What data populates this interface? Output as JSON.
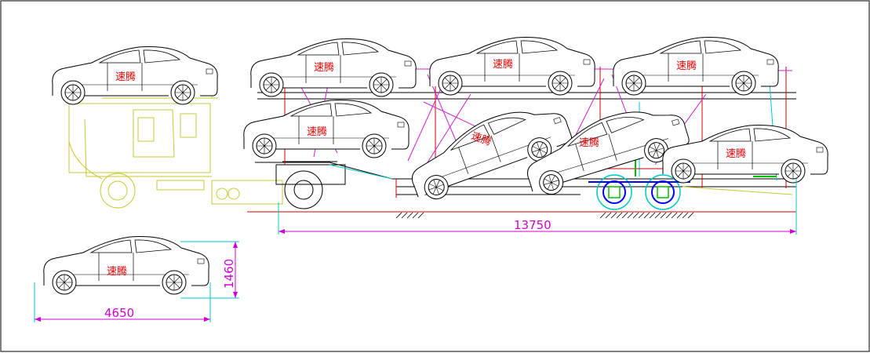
{
  "drawing": {
    "brand_label": "速腾",
    "dimensions": {
      "trailer_length": "13750",
      "car_length": "4650",
      "car_height": "1460"
    },
    "colors": {
      "car_outline": "#000000",
      "car_brand": "#e00000",
      "tractor": "#c8c832",
      "frame_magenta": "#d020d0",
      "frame_red": "#d00000",
      "dimension": "#d000d0",
      "extension": "#00c8c8",
      "axle": "#0000ff",
      "hydraulic": "#00c000"
    }
  }
}
